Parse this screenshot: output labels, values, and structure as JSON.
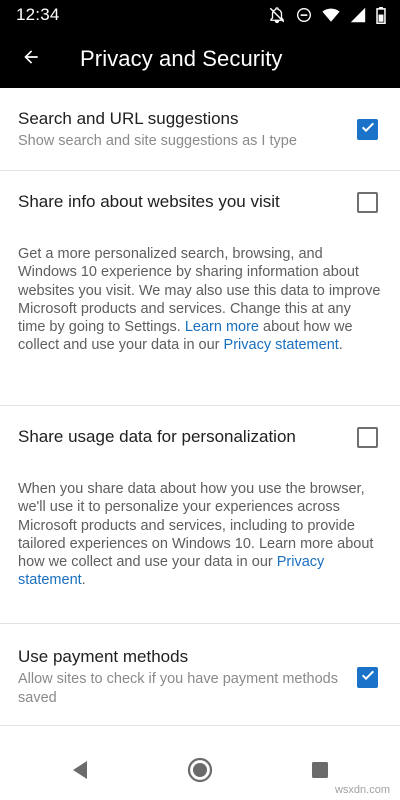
{
  "status_bar": {
    "time": "12:34",
    "icons": [
      "notifications-off-icon",
      "do-not-disturb-icon",
      "wifi-icon",
      "signal-icon",
      "battery-icon"
    ]
  },
  "app_bar": {
    "title": "Privacy and Security",
    "back_icon": "arrow-left-icon"
  },
  "settings": [
    {
      "title": "Search and URL suggestions",
      "subtitle": "Show search and site suggestions as I type",
      "checked": true
    },
    {
      "title": "Share info about websites you visit",
      "checked": false,
      "description_before_link": "Get a more personalized search, browsing, and Windows 10 experience by sharing information about websites you visit. We may also use this data to improve Microsoft products and services. Change this at any time by going to Settings. ",
      "link_learn_more": "Learn more",
      "description_middle": " about how we collect and use your data in our ",
      "link_privacy": "Privacy statement",
      "description_end": "."
    },
    {
      "title": "Share usage data for personalization",
      "checked": false,
      "description_before_link": "When you share data about how you use the browser, we'll use it to personalize your experiences across Microsoft products and services, including to provide tailored experiences on Windows 10. Learn more about how we collect and use your data in our ",
      "link_privacy": "Privacy statement",
      "description_end": "."
    },
    {
      "title": "Use payment methods",
      "subtitle": "Allow sites to check if you have payment methods saved",
      "checked": true
    }
  ],
  "nav_bar": {
    "icons": [
      "back-triangle-icon",
      "home-circle-icon",
      "recents-square-icon"
    ]
  },
  "watermark": "wsxdn.com",
  "colors": {
    "accent": "#1a73c8",
    "link": "#1a6fbf",
    "app_bar": "#000000"
  }
}
